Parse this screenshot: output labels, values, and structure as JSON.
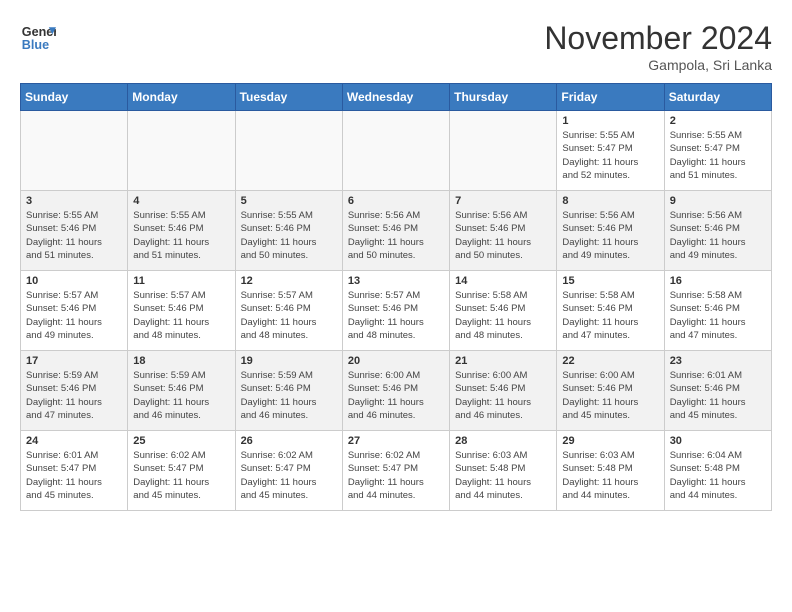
{
  "header": {
    "logo_line1": "General",
    "logo_line2": "Blue",
    "month_title": "November 2024",
    "location": "Gampola, Sri Lanka"
  },
  "weekdays": [
    "Sunday",
    "Monday",
    "Tuesday",
    "Wednesday",
    "Thursday",
    "Friday",
    "Saturday"
  ],
  "weeks": [
    [
      {
        "day": "",
        "info": ""
      },
      {
        "day": "",
        "info": ""
      },
      {
        "day": "",
        "info": ""
      },
      {
        "day": "",
        "info": ""
      },
      {
        "day": "",
        "info": ""
      },
      {
        "day": "1",
        "info": "Sunrise: 5:55 AM\nSunset: 5:47 PM\nDaylight: 11 hours\nand 52 minutes."
      },
      {
        "day": "2",
        "info": "Sunrise: 5:55 AM\nSunset: 5:47 PM\nDaylight: 11 hours\nand 51 minutes."
      }
    ],
    [
      {
        "day": "3",
        "info": "Sunrise: 5:55 AM\nSunset: 5:46 PM\nDaylight: 11 hours\nand 51 minutes."
      },
      {
        "day": "4",
        "info": "Sunrise: 5:55 AM\nSunset: 5:46 PM\nDaylight: 11 hours\nand 51 minutes."
      },
      {
        "day": "5",
        "info": "Sunrise: 5:55 AM\nSunset: 5:46 PM\nDaylight: 11 hours\nand 50 minutes."
      },
      {
        "day": "6",
        "info": "Sunrise: 5:56 AM\nSunset: 5:46 PM\nDaylight: 11 hours\nand 50 minutes."
      },
      {
        "day": "7",
        "info": "Sunrise: 5:56 AM\nSunset: 5:46 PM\nDaylight: 11 hours\nand 50 minutes."
      },
      {
        "day": "8",
        "info": "Sunrise: 5:56 AM\nSunset: 5:46 PM\nDaylight: 11 hours\nand 49 minutes."
      },
      {
        "day": "9",
        "info": "Sunrise: 5:56 AM\nSunset: 5:46 PM\nDaylight: 11 hours\nand 49 minutes."
      }
    ],
    [
      {
        "day": "10",
        "info": "Sunrise: 5:57 AM\nSunset: 5:46 PM\nDaylight: 11 hours\nand 49 minutes."
      },
      {
        "day": "11",
        "info": "Sunrise: 5:57 AM\nSunset: 5:46 PM\nDaylight: 11 hours\nand 48 minutes."
      },
      {
        "day": "12",
        "info": "Sunrise: 5:57 AM\nSunset: 5:46 PM\nDaylight: 11 hours\nand 48 minutes."
      },
      {
        "day": "13",
        "info": "Sunrise: 5:57 AM\nSunset: 5:46 PM\nDaylight: 11 hours\nand 48 minutes."
      },
      {
        "day": "14",
        "info": "Sunrise: 5:58 AM\nSunset: 5:46 PM\nDaylight: 11 hours\nand 48 minutes."
      },
      {
        "day": "15",
        "info": "Sunrise: 5:58 AM\nSunset: 5:46 PM\nDaylight: 11 hours\nand 47 minutes."
      },
      {
        "day": "16",
        "info": "Sunrise: 5:58 AM\nSunset: 5:46 PM\nDaylight: 11 hours\nand 47 minutes."
      }
    ],
    [
      {
        "day": "17",
        "info": "Sunrise: 5:59 AM\nSunset: 5:46 PM\nDaylight: 11 hours\nand 47 minutes."
      },
      {
        "day": "18",
        "info": "Sunrise: 5:59 AM\nSunset: 5:46 PM\nDaylight: 11 hours\nand 46 minutes."
      },
      {
        "day": "19",
        "info": "Sunrise: 5:59 AM\nSunset: 5:46 PM\nDaylight: 11 hours\nand 46 minutes."
      },
      {
        "day": "20",
        "info": "Sunrise: 6:00 AM\nSunset: 5:46 PM\nDaylight: 11 hours\nand 46 minutes."
      },
      {
        "day": "21",
        "info": "Sunrise: 6:00 AM\nSunset: 5:46 PM\nDaylight: 11 hours\nand 46 minutes."
      },
      {
        "day": "22",
        "info": "Sunrise: 6:00 AM\nSunset: 5:46 PM\nDaylight: 11 hours\nand 45 minutes."
      },
      {
        "day": "23",
        "info": "Sunrise: 6:01 AM\nSunset: 5:46 PM\nDaylight: 11 hours\nand 45 minutes."
      }
    ],
    [
      {
        "day": "24",
        "info": "Sunrise: 6:01 AM\nSunset: 5:47 PM\nDaylight: 11 hours\nand 45 minutes."
      },
      {
        "day": "25",
        "info": "Sunrise: 6:02 AM\nSunset: 5:47 PM\nDaylight: 11 hours\nand 45 minutes."
      },
      {
        "day": "26",
        "info": "Sunrise: 6:02 AM\nSunset: 5:47 PM\nDaylight: 11 hours\nand 45 minutes."
      },
      {
        "day": "27",
        "info": "Sunrise: 6:02 AM\nSunset: 5:47 PM\nDaylight: 11 hours\nand 44 minutes."
      },
      {
        "day": "28",
        "info": "Sunrise: 6:03 AM\nSunset: 5:48 PM\nDaylight: 11 hours\nand 44 minutes."
      },
      {
        "day": "29",
        "info": "Sunrise: 6:03 AM\nSunset: 5:48 PM\nDaylight: 11 hours\nand 44 minutes."
      },
      {
        "day": "30",
        "info": "Sunrise: 6:04 AM\nSunset: 5:48 PM\nDaylight: 11 hours\nand 44 minutes."
      }
    ]
  ]
}
